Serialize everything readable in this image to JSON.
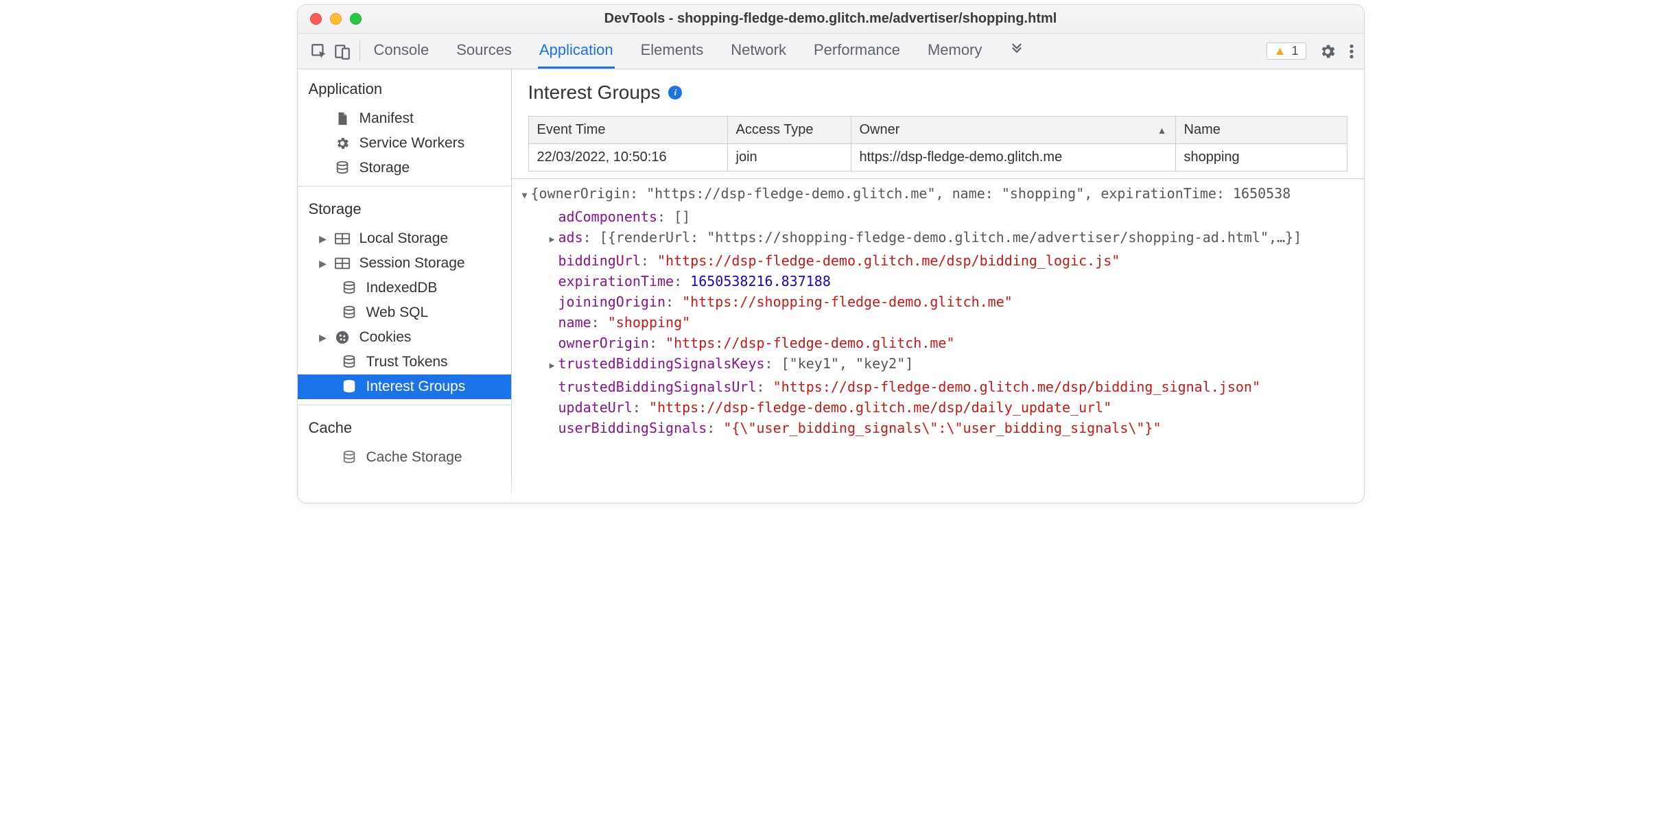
{
  "window_title": "DevTools - shopping-fledge-demo.glitch.me/advertiser/shopping.html",
  "tabs": {
    "console": "Console",
    "sources": "Sources",
    "application": "Application",
    "elements": "Elements",
    "network": "Network",
    "performance": "Performance",
    "memory": "Memory"
  },
  "warning_count": "1",
  "sidebar": {
    "group_application": "Application",
    "manifest": "Manifest",
    "service_workers": "Service Workers",
    "storage_item": "Storage",
    "group_storage": "Storage",
    "local_storage": "Local Storage",
    "session_storage": "Session Storage",
    "indexeddb": "IndexedDB",
    "websql": "Web SQL",
    "cookies": "Cookies",
    "trust_tokens": "Trust Tokens",
    "interest_groups": "Interest Groups",
    "group_cache": "Cache",
    "cache_storage": "Cache Storage"
  },
  "panel": {
    "title": "Interest Groups",
    "columns": {
      "event_time": "Event Time",
      "access_type": "Access Type",
      "owner": "Owner",
      "name": "Name"
    },
    "row": {
      "event_time": "22/03/2022, 10:50:16",
      "access_type": "join",
      "owner": "https://dsp-fledge-demo.glitch.me",
      "name": "shopping"
    }
  },
  "tree": {
    "summary": "{ownerOrigin: \"https://dsp-fledge-demo.glitch.me\", name: \"shopping\", expirationTime: 1650538",
    "adComponents_k": "adComponents",
    "adComponents_v": "[]",
    "ads_k": "ads",
    "ads_v": "[{renderUrl: \"https://shopping-fledge-demo.glitch.me/advertiser/shopping-ad.html\",…}]",
    "biddingUrl_k": "biddingUrl",
    "biddingUrl_v": "\"https://dsp-fledge-demo.glitch.me/dsp/bidding_logic.js\"",
    "expirationTime_k": "expirationTime",
    "expirationTime_v": "1650538216.837188",
    "joiningOrigin_k": "joiningOrigin",
    "joiningOrigin_v": "\"https://shopping-fledge-demo.glitch.me\"",
    "name_k": "name",
    "name_v": "\"shopping\"",
    "ownerOrigin_k": "ownerOrigin",
    "ownerOrigin_v": "\"https://dsp-fledge-demo.glitch.me\"",
    "tbsk_k": "trustedBiddingSignalsKeys",
    "tbsk_v": "[\"key1\", \"key2\"]",
    "tbsu_k": "trustedBiddingSignalsUrl",
    "tbsu_v": "\"https://dsp-fledge-demo.glitch.me/dsp/bidding_signal.json\"",
    "updateUrl_k": "updateUrl",
    "updateUrl_v": "\"https://dsp-fledge-demo.glitch.me/dsp/daily_update_url\"",
    "userBiddingSignals_k": "userBiddingSignals",
    "userBiddingSignals_v": "\"{\\\"user_bidding_signals\\\":\\\"user_bidding_signals\\\"}\""
  }
}
